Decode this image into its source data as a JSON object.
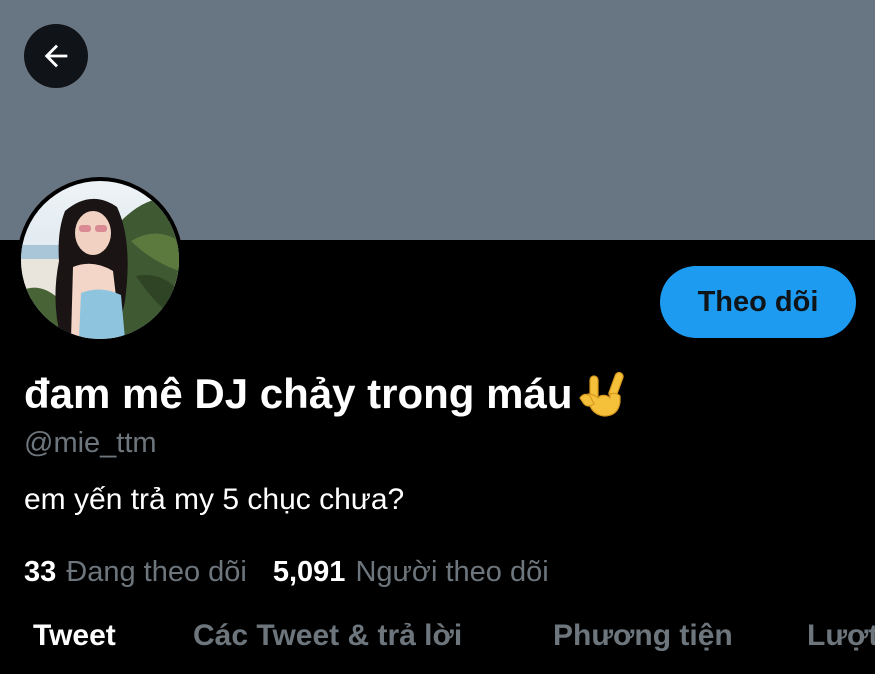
{
  "header": {
    "back_icon": "arrow-left-icon",
    "banner_color": "#687684"
  },
  "profile": {
    "display_name": "đam mê DJ chảy trong máu",
    "name_emoji": "🤟",
    "handle": "@mie_ttm",
    "bio": "em yến trả my 5 chục chưa?",
    "follow_button_label": "Theo dõi",
    "accent_color": "#1d9bf0"
  },
  "stats": {
    "following_count": "33",
    "following_label": "Đang theo dõi",
    "followers_count": "5,091",
    "followers_label": "Người theo dõi"
  },
  "tabs": [
    {
      "label": "Tweet",
      "active": true
    },
    {
      "label": "Các Tweet & trả lời",
      "active": false
    },
    {
      "label": "Phương tiện",
      "active": false
    },
    {
      "label": "Lượt thích",
      "active": false
    }
  ]
}
